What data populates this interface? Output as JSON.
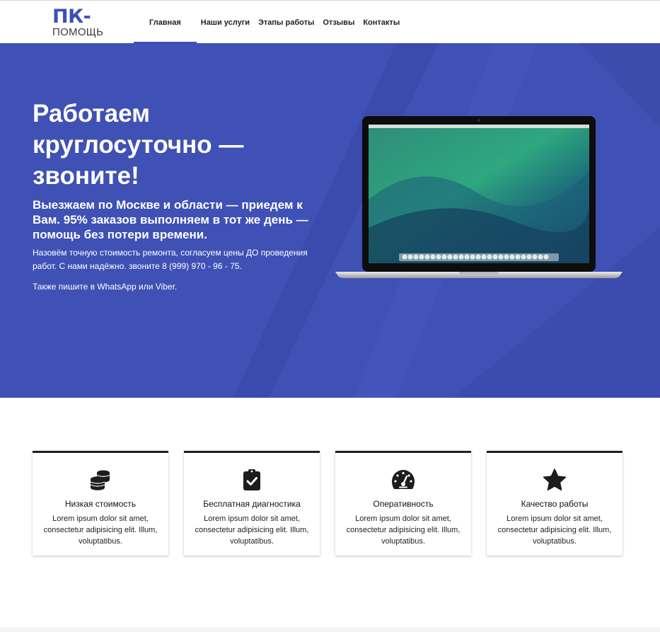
{
  "logo": {
    "top": "ПК-",
    "bottom": "ПОМОЩЬ"
  },
  "nav": [
    {
      "label": "Главная"
    },
    {
      "label": "Наши услуги"
    },
    {
      "label": "Этапы работы"
    },
    {
      "label": "Отзывы"
    },
    {
      "label": "Контакты"
    }
  ],
  "hero": {
    "title": "Работаем круглосуточно — звоните!",
    "subtitle": "Выезжаем по Москве и области — приедем к Вам. 95% заказов выполняем в тот же день — помощь без потери времени.",
    "text1": "Назовём точную стоимость ремонта, согласуем цены ДО проведения работ. С нами надёжно. звоните 8 (999) 970 - 96 - 75.",
    "text2": "Также пишите в WhatsApp или Viber."
  },
  "features": [
    {
      "icon": "coins-icon",
      "title": "Низкая стоимость",
      "text": "Lorem ipsum dolor sit amet, consectetur adipisicing elit. Illum, voluptatibus."
    },
    {
      "icon": "clipboard-check-icon",
      "title": "Бесплатная диагностика",
      "text": "Lorem ipsum dolor sit amet, consectetur adipisicing elit. Illum, voluptatibus."
    },
    {
      "icon": "speedometer-icon",
      "title": "Оперативность",
      "text": "Lorem ipsum dolor sit amet, consectetur adipisicing elit. Illum, voluptatibus."
    },
    {
      "icon": "star-icon",
      "title": "Качество работы",
      "text": "Lorem ipsum dolor sit amet, consectetur adipisicing elit. Illum, voluptatibus."
    }
  ],
  "colors": {
    "brand": "#3f51b5",
    "dark": "#212121"
  }
}
